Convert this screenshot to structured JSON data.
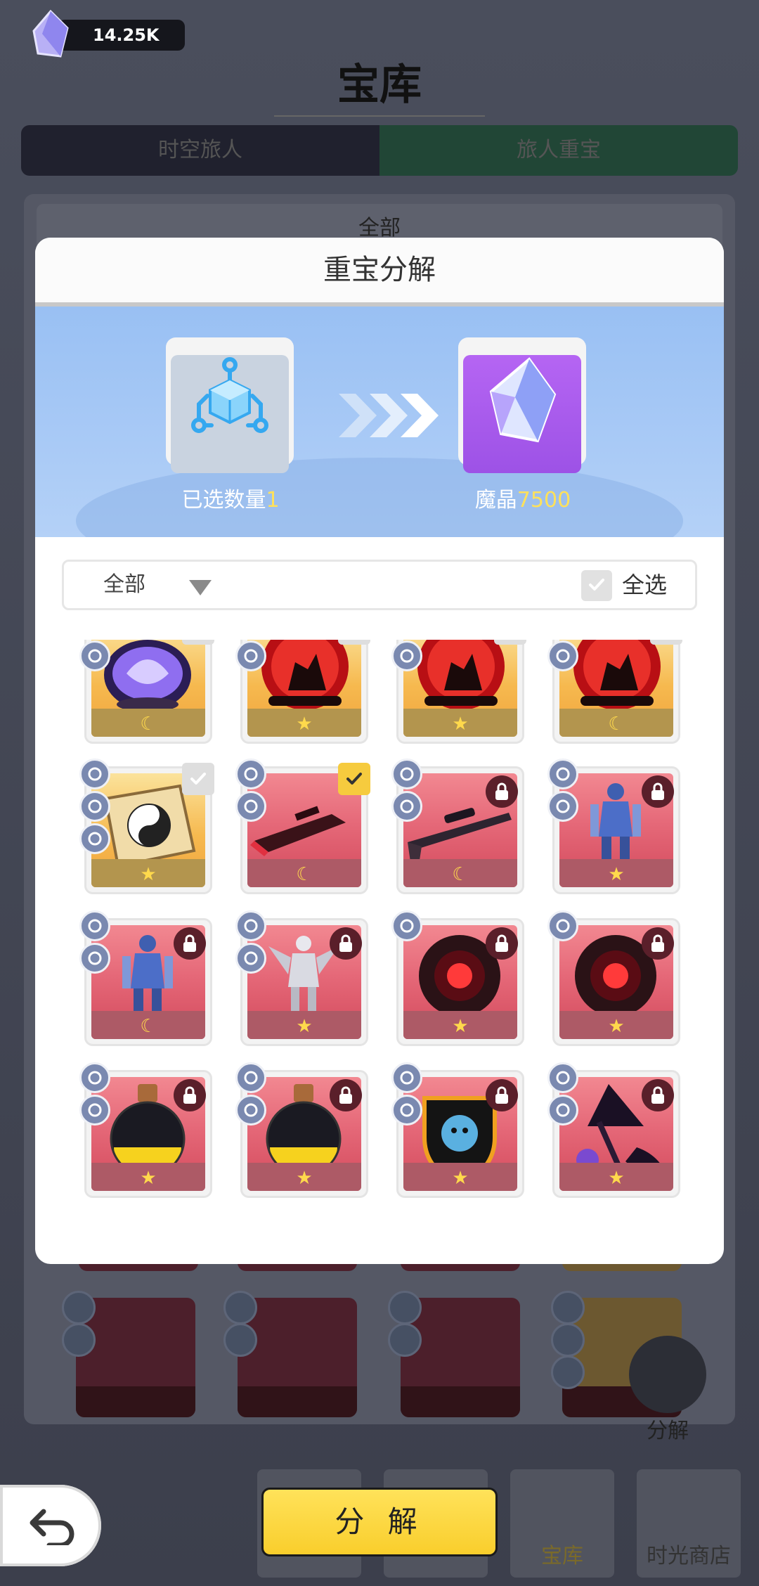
{
  "currency": {
    "amount": "14.25K",
    "icon": "crystal-icon"
  },
  "page": {
    "title": "宝库",
    "tabs": [
      "时空旅人",
      "旅人重宝"
    ],
    "filter_label": "全部",
    "side_button_label": "分解",
    "nav": [
      {
        "label": ""
      },
      {
        "label": ""
      },
      {
        "label": "宝库"
      },
      {
        "label": "时光商店"
      }
    ]
  },
  "dialog": {
    "title": "重宝分解",
    "selected_label": "已选数量",
    "selected_count": "1",
    "reward_label": "魔晶",
    "reward_amount": "7500",
    "filter_value": "全部",
    "select_all_label": "全选",
    "items": [
      {
        "art": "purple-orb",
        "bg": "gold",
        "rank": "moon",
        "tags": [
          "hood-icon",
          "castle-icon"
        ],
        "state": "select"
      },
      {
        "art": "fighters-orb",
        "bg": "gold",
        "rank": "star",
        "tags": [
          "sun-icon",
          "lightning-icon"
        ],
        "state": "select"
      },
      {
        "art": "fighters-orb",
        "bg": "gold",
        "rank": "star",
        "tags": [
          "sun-icon",
          "lightning-icon"
        ],
        "state": "select"
      },
      {
        "art": "fighters-orb",
        "bg": "gold",
        "rank": "moon",
        "tags": [
          "sun-icon",
          "lightning-icon"
        ],
        "state": "select"
      },
      {
        "art": "yinyang-book",
        "bg": "gold",
        "rank": "star",
        "tags": [
          "person-icon",
          "scales-icon",
          "swords-icon"
        ],
        "state": "select"
      },
      {
        "art": "blaster-gun",
        "bg": "red",
        "rank": "moon",
        "tags": [
          "crosshair-icon",
          "flag-icon"
        ],
        "state": "selected"
      },
      {
        "art": "sniper-rifle",
        "bg": "red",
        "rank": "moon",
        "tags": [
          "crosshair-icon",
          "rabbit-icon"
        ],
        "state": "locked"
      },
      {
        "art": "blue-mech",
        "bg": "red",
        "rank": "star",
        "tags": [
          "vehicle-icon",
          "flame-icon"
        ],
        "state": "locked"
      },
      {
        "art": "blue-mech",
        "bg": "red",
        "rank": "moon",
        "tags": [
          "vehicle-icon",
          "flame-icon"
        ],
        "state": "locked"
      },
      {
        "art": "white-mech",
        "bg": "red",
        "rank": "star",
        "tags": [
          "vehicle-icon",
          "mountain-icon"
        ],
        "state": "locked"
      },
      {
        "art": "dark-vortex",
        "bg": "red",
        "rank": "star",
        "tags": [
          "rocket-icon"
        ],
        "state": "locked"
      },
      {
        "art": "dark-vortex",
        "bg": "red",
        "rank": "star",
        "tags": [
          "rocket-icon"
        ],
        "state": "locked"
      },
      {
        "art": "golden-potion",
        "bg": "red",
        "rank": "star",
        "tags": [
          "refresh-icon",
          "snowflake-icon"
        ],
        "state": "locked"
      },
      {
        "art": "golden-potion",
        "bg": "red",
        "rank": "star",
        "tags": [
          "refresh-icon",
          "snowflake-icon"
        ],
        "state": "locked"
      },
      {
        "art": "beast-shield",
        "bg": "red",
        "rank": "star",
        "tags": [
          "shield-icon",
          "mountain-icon"
        ],
        "state": "locked"
      },
      {
        "art": "witch-staff",
        "bg": "red",
        "rank": "star",
        "tags": [
          "sword-icon",
          "scales-icon"
        ],
        "state": "locked"
      }
    ]
  },
  "bottom": {
    "decompose_button": "分 解",
    "back_icon": "back-arrow-icon"
  },
  "colors": {
    "accent_yellow": "#f9ce2c",
    "reward_number": "#ffe15a",
    "banner_blue": "#a9caf6",
    "card_red": "#e56878",
    "card_gold": "#f6b94f"
  }
}
